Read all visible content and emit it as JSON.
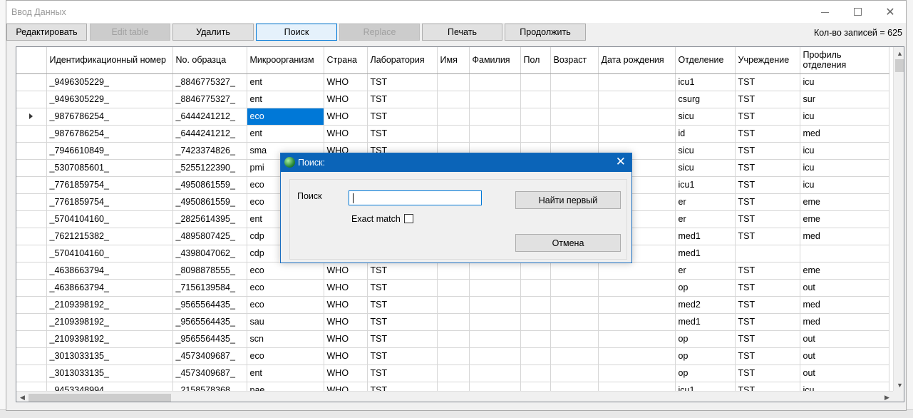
{
  "window": {
    "title": "Ввод Данных"
  },
  "toolbar": {
    "buttons": [
      {
        "label": "Редактировать",
        "state": "normal"
      },
      {
        "label": "Edit table",
        "state": "disabled"
      },
      {
        "label": "Удалить",
        "state": "normal"
      },
      {
        "label": "Поиск",
        "state": "active"
      },
      {
        "label": "Replace",
        "state": "disabled"
      },
      {
        "label": "Печать",
        "state": "normal"
      },
      {
        "label": "Продолжить",
        "state": "normal"
      }
    ],
    "record_count": "Кол-во записей = 625"
  },
  "grid": {
    "columns": [
      "Идентификационный номер",
      "No. образца",
      "Микроорганизм",
      "Страна",
      "Лаборатория",
      "Имя",
      "Фамилия",
      "Пол",
      "Возраст",
      "Дата рождения",
      "Отделение",
      "Учреждение",
      "Профиль отделения"
    ],
    "rows": [
      [
        "_9496305229_",
        "_8846775327_",
        "ent",
        "WHO",
        "TST",
        "",
        "",
        "",
        "",
        "",
        "icu1",
        "TST",
        "icu"
      ],
      [
        "_9496305229_",
        "_8846775327_",
        "ent",
        "WHO",
        "TST",
        "",
        "",
        "",
        "",
        "",
        "csurg",
        "TST",
        "sur"
      ],
      [
        "_9876786254_",
        "_6444241212_",
        "eco",
        "WHO",
        "TST",
        "",
        "",
        "",
        "",
        "",
        "sicu",
        "TST",
        "icu"
      ],
      [
        "_9876786254_",
        "_6444241212_",
        "ent",
        "WHO",
        "TST",
        "",
        "",
        "",
        "",
        "",
        "id",
        "TST",
        "med"
      ],
      [
        "_7946610849_",
        "_7423374826_",
        "sma",
        "WHO",
        "TST",
        "",
        "",
        "",
        "",
        "",
        "sicu",
        "TST",
        "icu"
      ],
      [
        "_5307085601_",
        "_5255122390_",
        "pmi",
        "",
        "",
        "",
        "",
        "",
        "",
        "",
        "sicu",
        "TST",
        "icu"
      ],
      [
        "_7761859754_",
        "_4950861559_",
        "eco",
        "",
        "",
        "",
        "",
        "",
        "",
        "",
        "icu1",
        "TST",
        "icu"
      ],
      [
        "_7761859754_",
        "_4950861559_",
        "eco",
        "",
        "",
        "",
        "",
        "",
        "",
        "",
        "er",
        "TST",
        "eme"
      ],
      [
        "_5704104160_",
        "_2825614395_",
        "ent",
        "",
        "",
        "",
        "",
        "",
        "",
        "",
        "er",
        "TST",
        "eme"
      ],
      [
        "_7621215382_",
        "_4895807425_",
        "cdp",
        "",
        "",
        "",
        "",
        "",
        "",
        "",
        "med1",
        "TST",
        "med"
      ],
      [
        "_5704104160_",
        "_4398047062_",
        "cdp",
        "",
        "",
        "",
        "",
        "",
        "",
        "",
        "med1",
        "",
        ""
      ],
      [
        "_4638663794_",
        "_8098878555_",
        "eco",
        "WHO",
        "TST",
        "",
        "",
        "",
        "",
        "",
        "er",
        "TST",
        "eme"
      ],
      [
        "_4638663794_",
        "_7156139584_",
        "eco",
        "WHO",
        "TST",
        "",
        "",
        "",
        "",
        "",
        "op",
        "TST",
        "out"
      ],
      [
        "_2109398192_",
        "_9565564435_",
        "eco",
        "WHO",
        "TST",
        "",
        "",
        "",
        "",
        "",
        "med2",
        "TST",
        "med"
      ],
      [
        "_2109398192_",
        "_9565564435_",
        "sau",
        "WHO",
        "TST",
        "",
        "",
        "",
        "",
        "",
        "med1",
        "TST",
        "med"
      ],
      [
        "_2109398192_",
        "_9565564435_",
        "scn",
        "WHO",
        "TST",
        "",
        "",
        "",
        "",
        "",
        "op",
        "TST",
        "out"
      ],
      [
        "_3013033135_",
        "_4573409687_",
        "eco",
        "WHO",
        "TST",
        "",
        "",
        "",
        "",
        "",
        "op",
        "TST",
        "out"
      ],
      [
        "_3013033135_",
        "_4573409687_",
        "ent",
        "WHO",
        "TST",
        "",
        "",
        "",
        "",
        "",
        "op",
        "TST",
        "out"
      ],
      [
        "_9453348994_",
        "_2158578368_",
        "pae",
        "WHO",
        "TST",
        "",
        "",
        "",
        "",
        "",
        "icu1",
        "TST",
        "icu"
      ]
    ],
    "current_row": 2,
    "selected_cell": {
      "row": 2,
      "col": 2
    }
  },
  "dialog": {
    "title": "Поиск:",
    "search_label": "Поиск",
    "search_value": "",
    "exact_match_label": "Exact match",
    "exact_match_checked": false,
    "find_first_label": "Найти первый",
    "cancel_label": "Отмена"
  },
  "colors": {
    "selection": "#0078d7",
    "dialog_title_bg": "#0b64b8"
  }
}
